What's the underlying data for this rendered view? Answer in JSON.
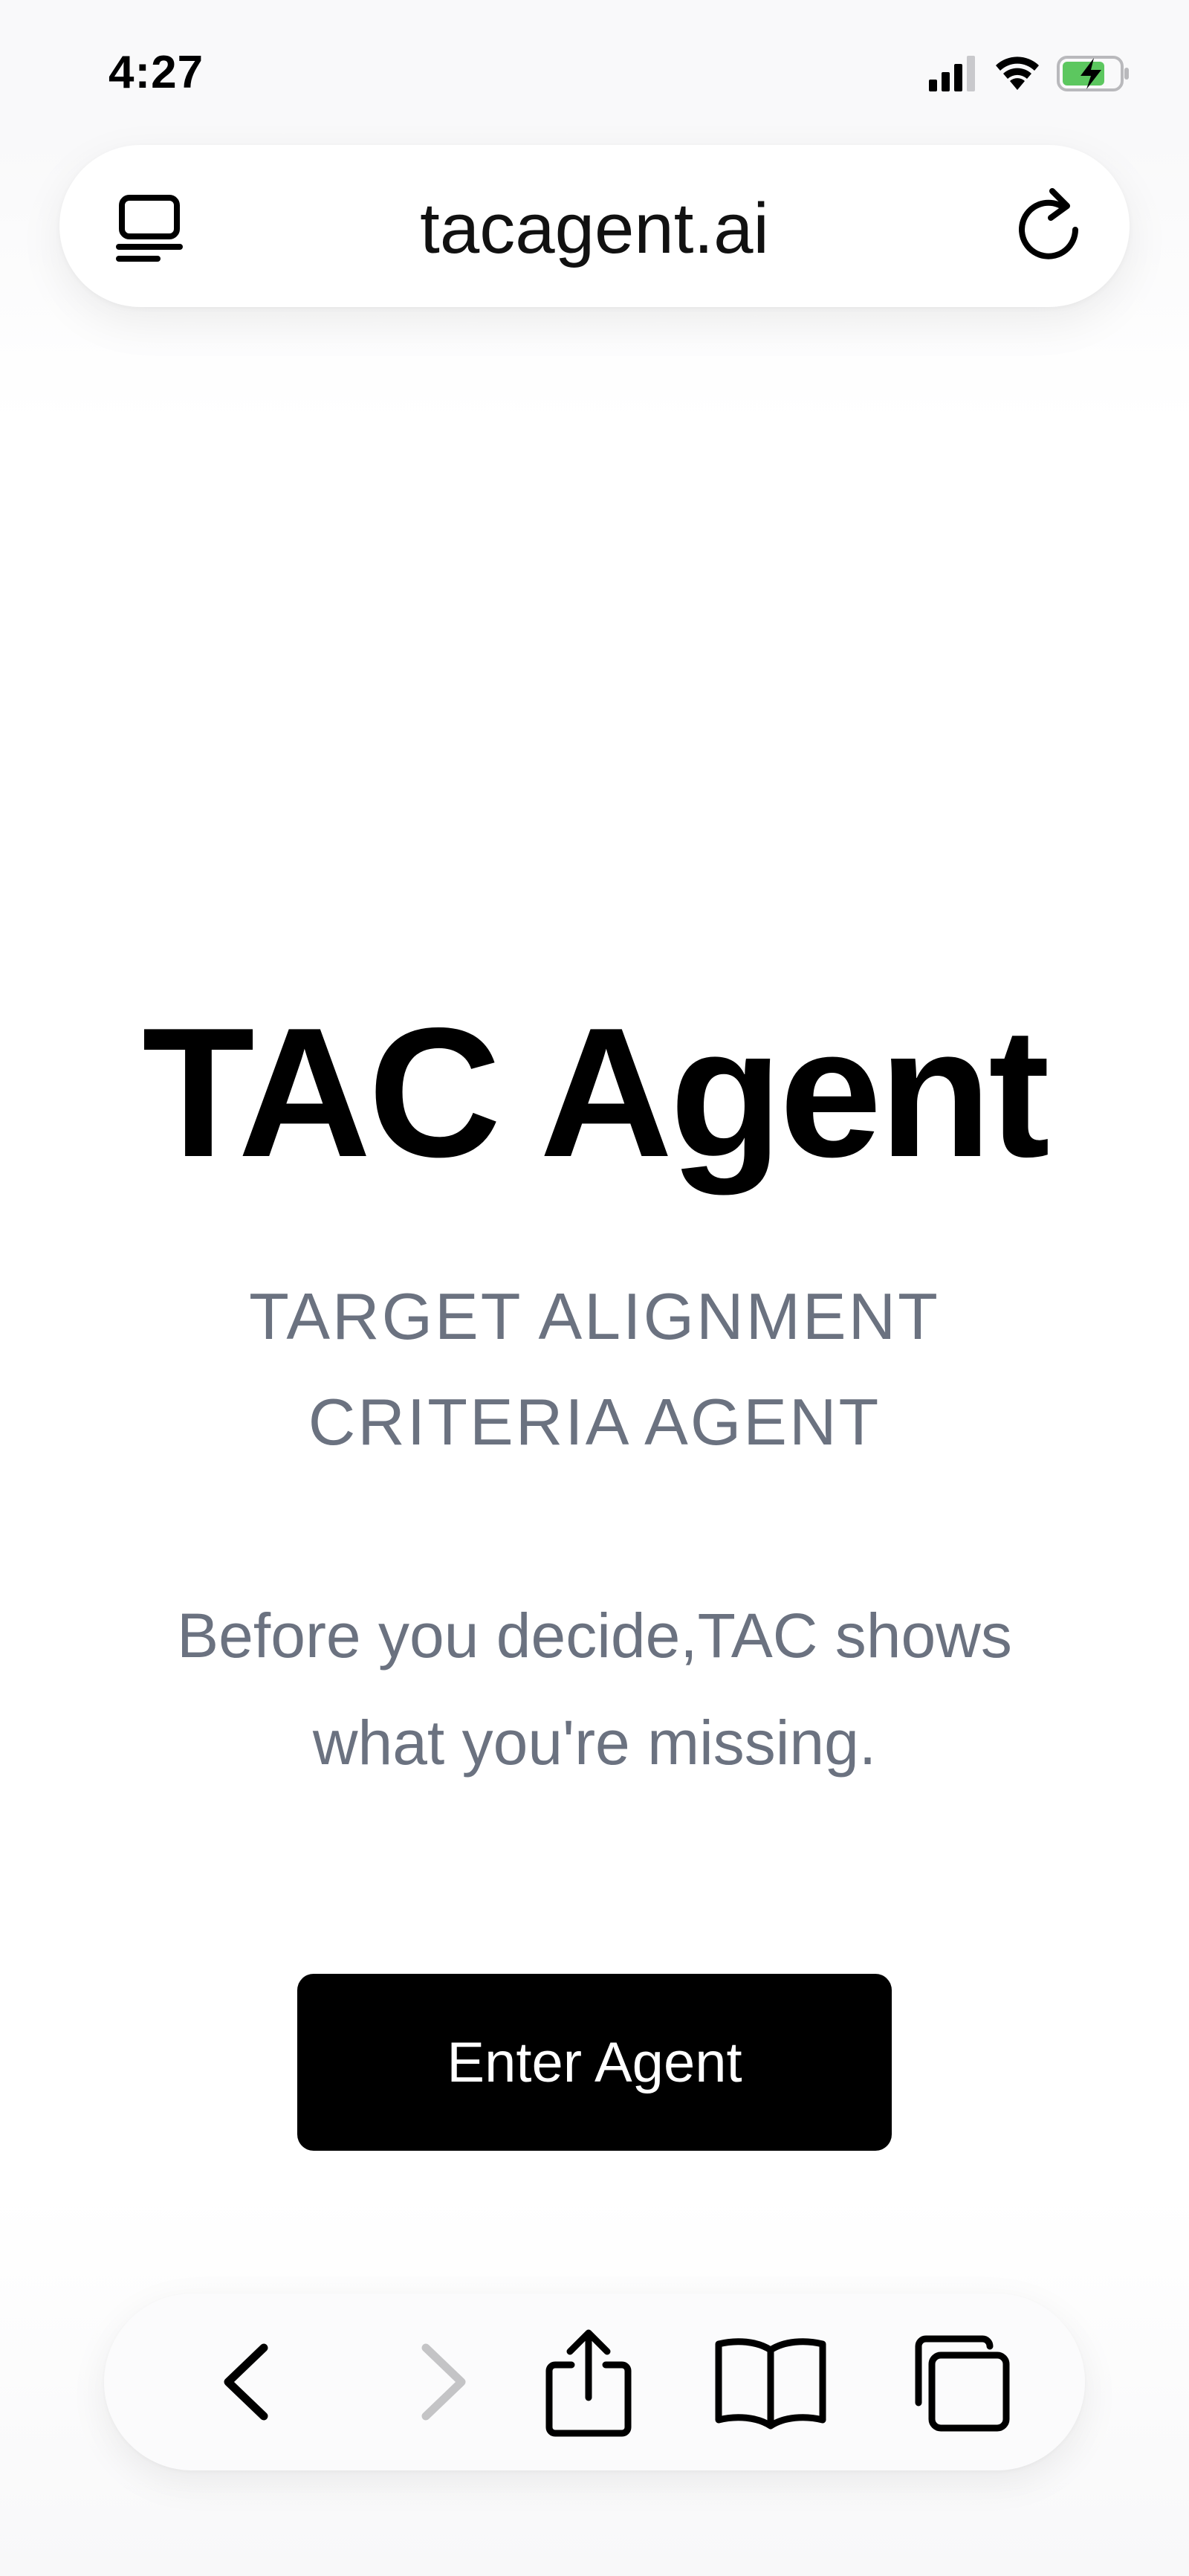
{
  "status_bar": {
    "time": "4:27"
  },
  "browser": {
    "url": "tacagent.ai"
  },
  "hero": {
    "title": "TAC Agent",
    "subtitle_line1": "TARGET ALIGNMENT",
    "subtitle_line2": "CRITERIA AGENT",
    "tagline_line1": "Before you decide,TAC shows",
    "tagline_line2": "what you're missing.",
    "button_label": "Enter Agent"
  },
  "icons": {
    "status": [
      "cellular-signal-icon",
      "wifi-icon",
      "battery-charging-icon"
    ],
    "url_bar": [
      "tab-overview-icon",
      "reload-icon"
    ],
    "toolbar": [
      "back-icon",
      "forward-icon",
      "share-icon",
      "bookmarks-icon",
      "tabs-icon"
    ]
  },
  "colors": {
    "text_primary": "#000000",
    "text_secondary": "#6b7280",
    "button_bg": "#000000",
    "button_text": "#ffffff",
    "battery_fill": "#5cc75f",
    "disabled_icon": "#c4c4c6"
  }
}
